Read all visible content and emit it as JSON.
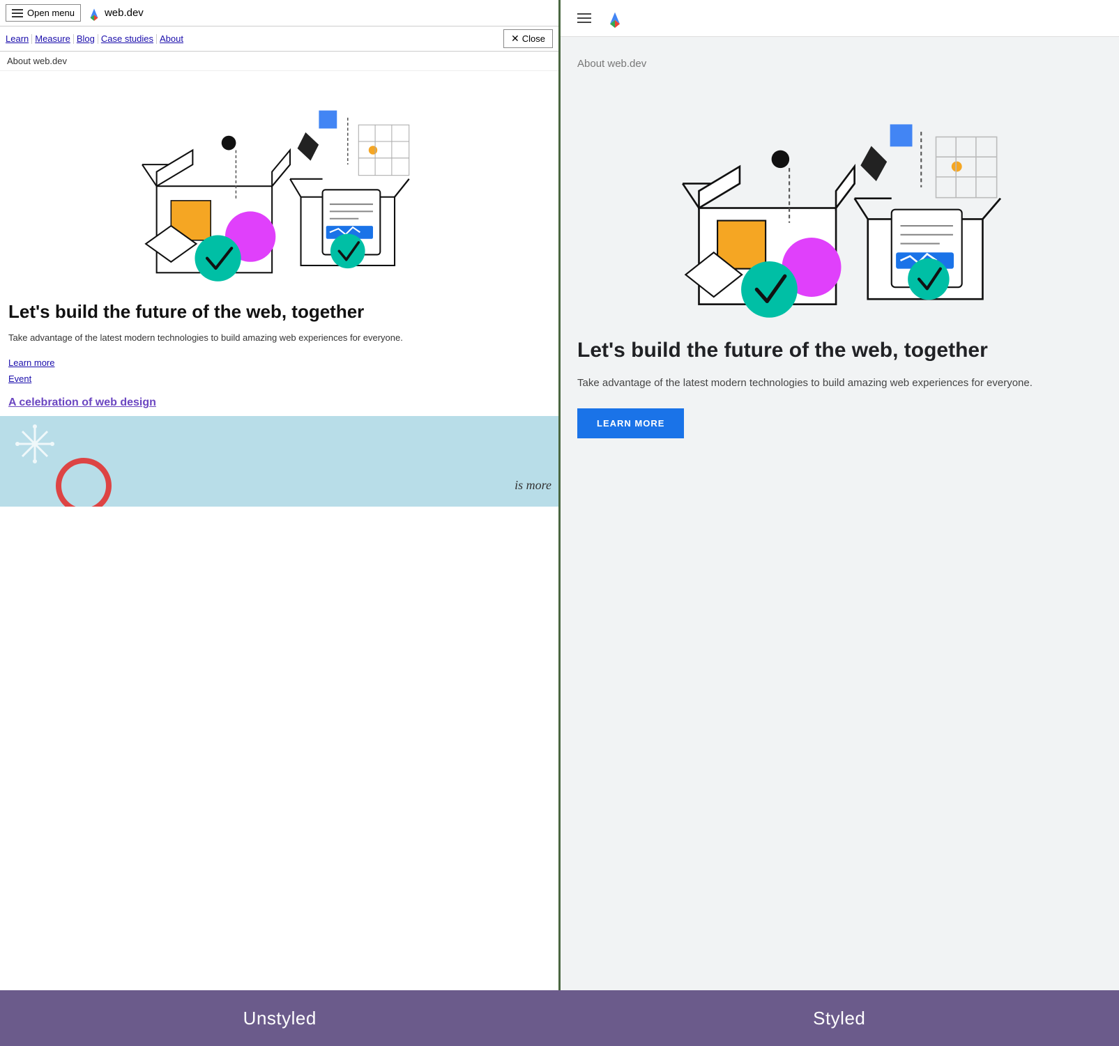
{
  "left": {
    "menu_button": "Open menu",
    "site_name": "web.dev",
    "nav_links": [
      "Learn",
      "Measure",
      "Blog",
      "Case studies",
      "About"
    ],
    "close_button": "Close",
    "about_label": "About web.dev",
    "heading": "Let's build the future of the web, together",
    "description": "Take advantage of the latest modern technologies to build amazing web experiences for everyone.",
    "link_learn_more": "Learn more",
    "link_event": "Event",
    "link_celebration": "A celebration of web design"
  },
  "right": {
    "about_label": "About web.dev",
    "heading": "Let's build the future of the web, together",
    "description": "Take advantage of the latest modern technologies to build amazing web experiences for everyone.",
    "learn_more_button": "LEARN MORE"
  },
  "labels": {
    "unstyled": "Unstyled",
    "styled": "Styled"
  }
}
